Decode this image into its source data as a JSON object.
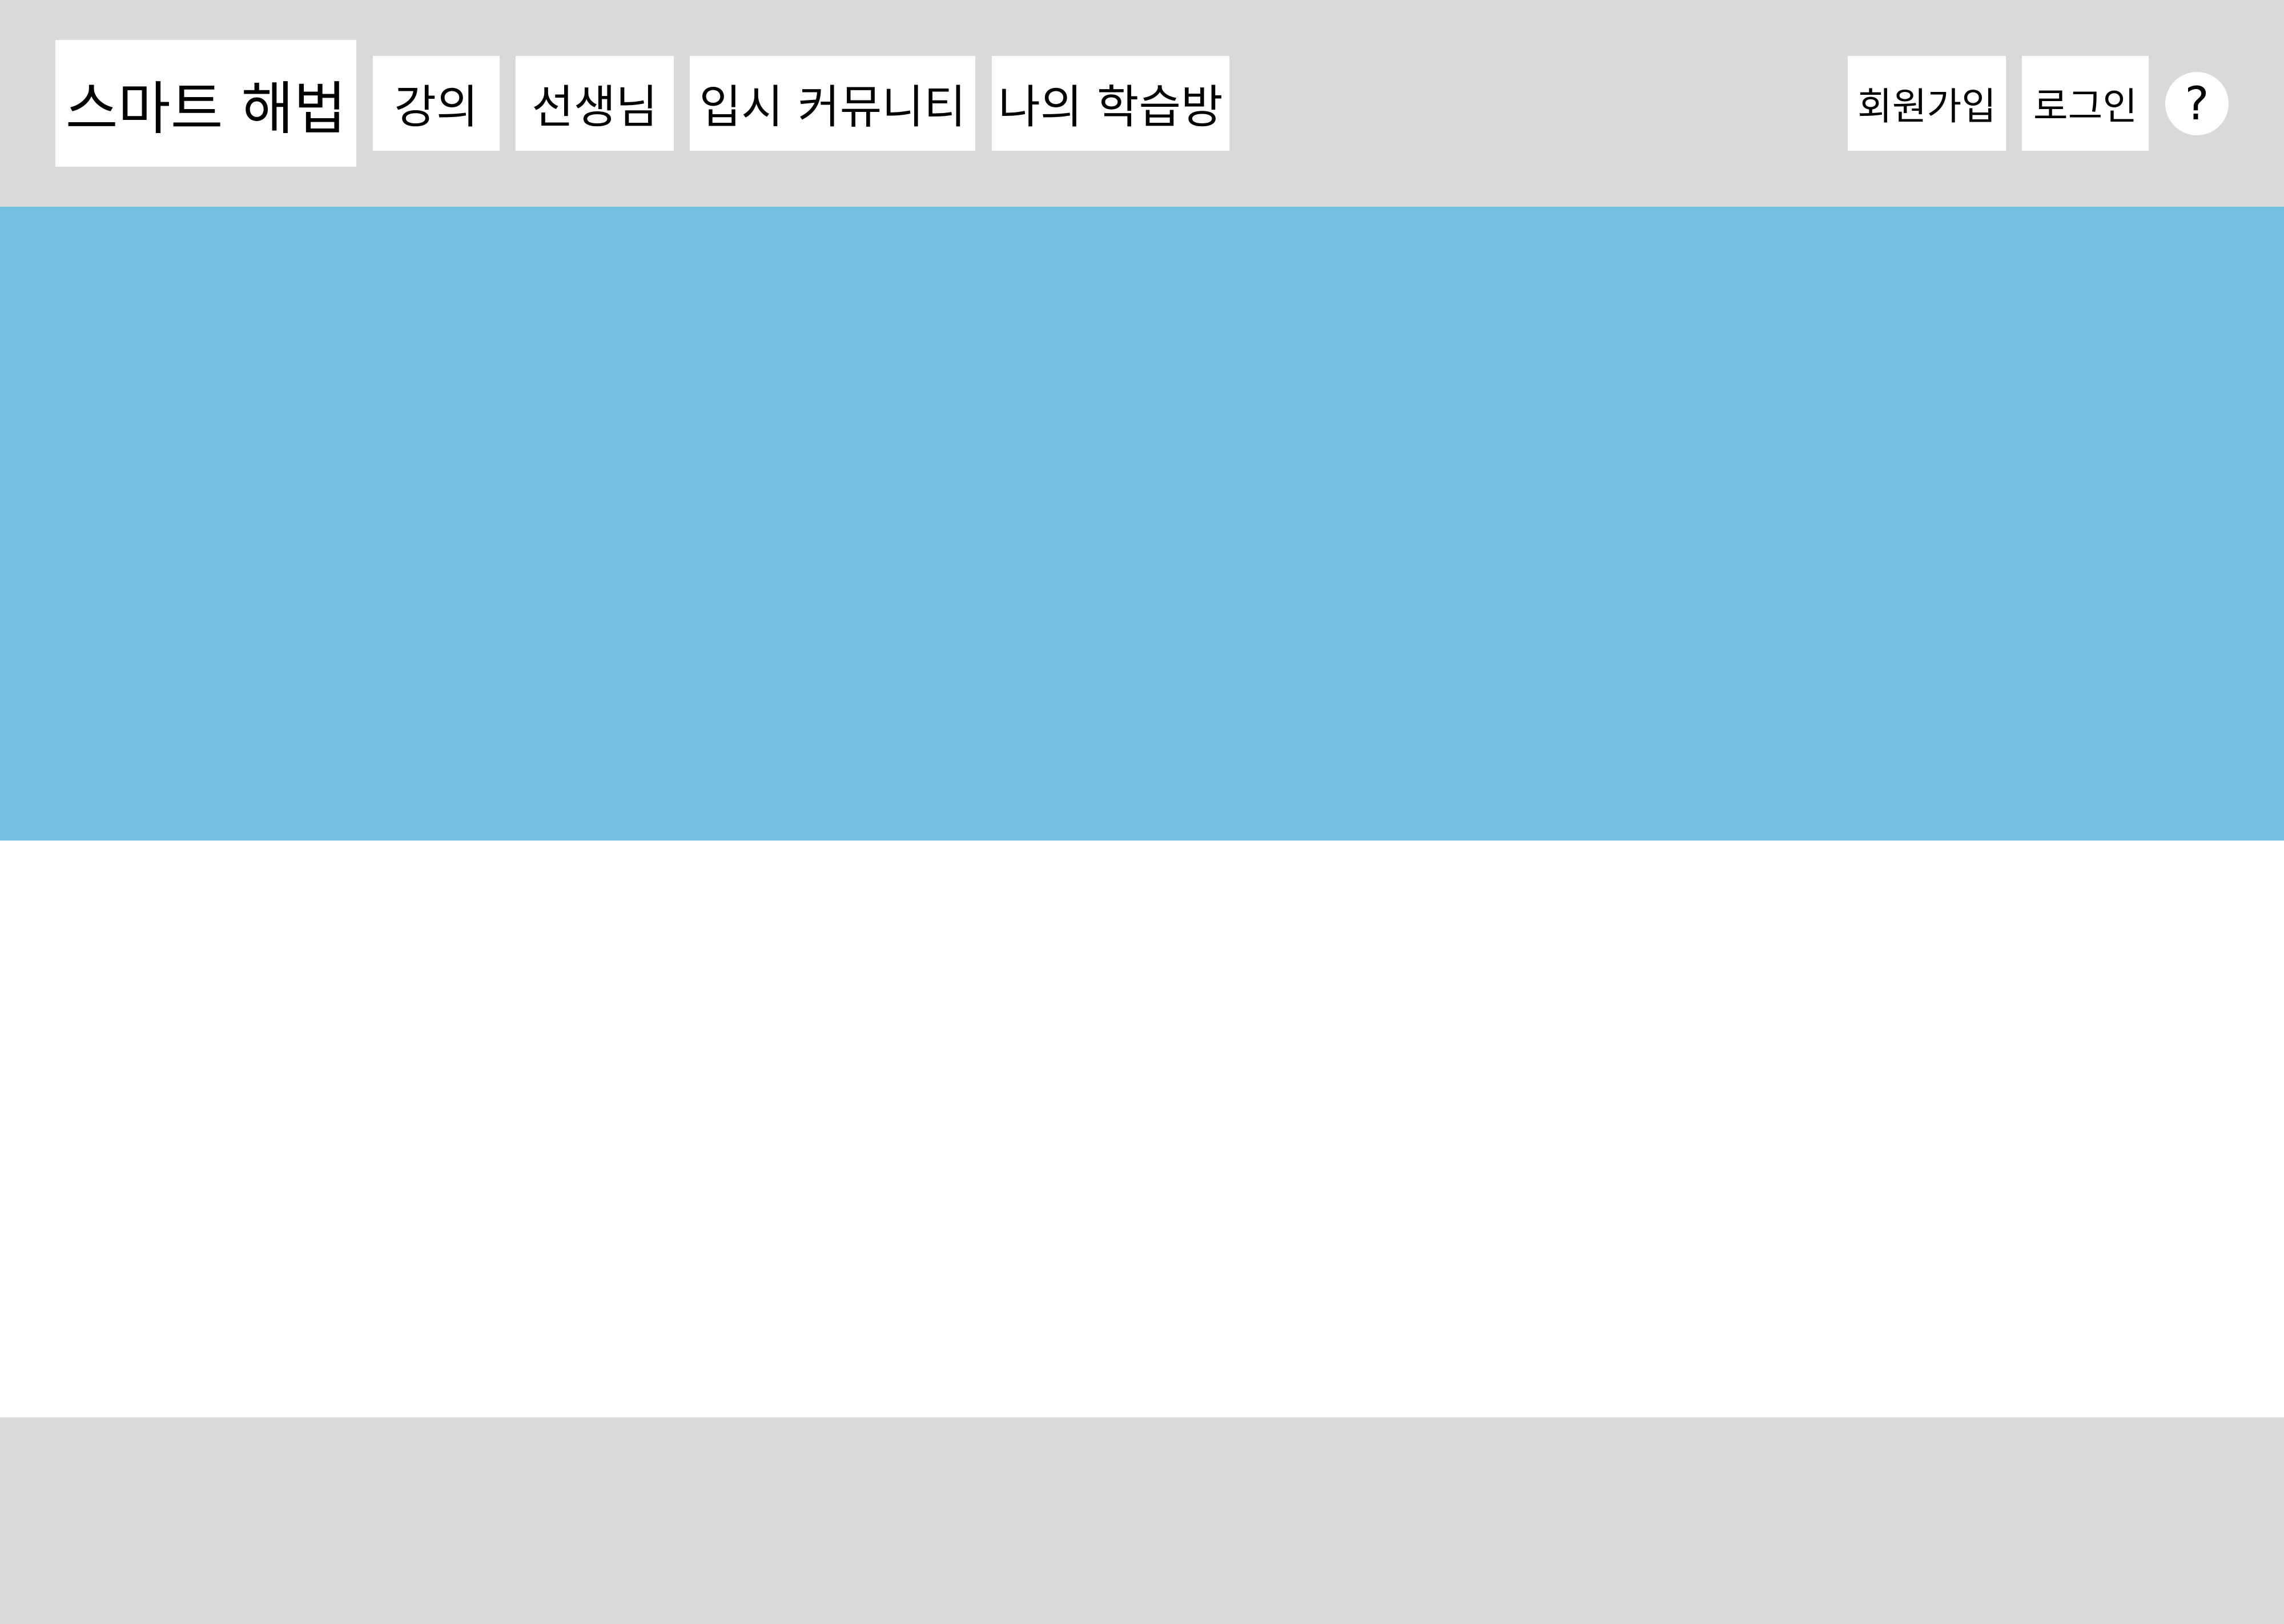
{
  "header": {
    "logo_text": "스마트 해법",
    "nav": {
      "lecture": "강의",
      "teacher": "선생님",
      "community": "입시 커뮤니티",
      "myroom": "나의 학습방"
    },
    "signup_label": "회원가입",
    "login_label": "로그인",
    "help_label": "?"
  },
  "colors": {
    "header_bg": "#d9d9d9",
    "banner_bg": "#73c0e1",
    "content_bg": "#ffffff",
    "footer_bg": "#d9d9d9"
  }
}
